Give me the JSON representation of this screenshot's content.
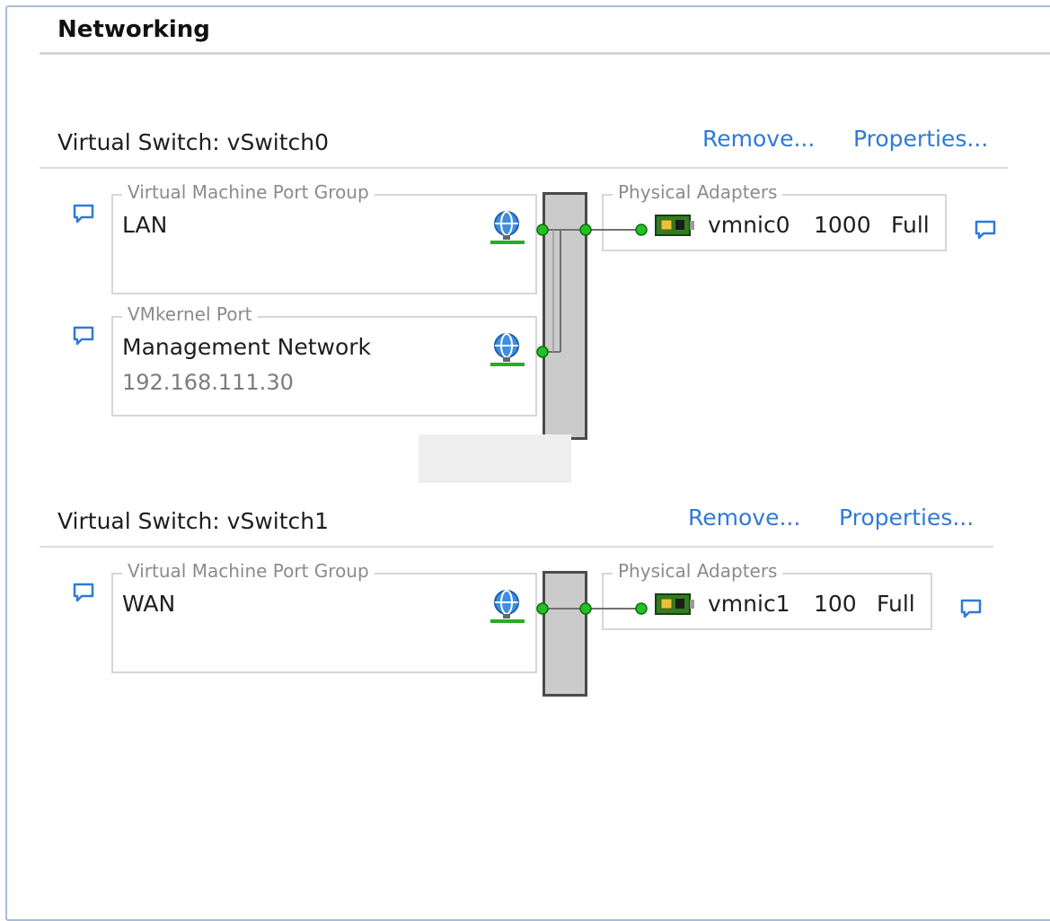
{
  "page": {
    "title": "Networking"
  },
  "switches": [
    {
      "title": "Virtual Switch: vSwitch0",
      "remove_label": "Remove...",
      "properties_label": "Properties...",
      "port_groups": [
        {
          "legend": "Virtual Machine Port Group",
          "name": "LAN"
        },
        {
          "legend": "VMkernel Port",
          "name": "Management Network",
          "ip": "192.168.111.30"
        }
      ],
      "adapters": {
        "legend": "Physical Adapters",
        "nic": "vmnic0",
        "speed": "1000",
        "duplex": "Full"
      }
    },
    {
      "title": "Virtual Switch: vSwitch1",
      "remove_label": "Remove...",
      "properties_label": "Properties...",
      "port_groups": [
        {
          "legend": "Virtual Machine Port Group",
          "name": "WAN"
        }
      ],
      "adapters": {
        "legend": "Physical Adapters",
        "nic": "vmnic1",
        "speed": "100",
        "duplex": "Full"
      }
    }
  ],
  "icons": {
    "comment": "comment-icon",
    "port": "globe-port-icon",
    "nic": "network-card-icon"
  },
  "colors": {
    "link": "#2f7ad6",
    "connector": "#22c022",
    "switch_fill": "#cbcbcb"
  }
}
